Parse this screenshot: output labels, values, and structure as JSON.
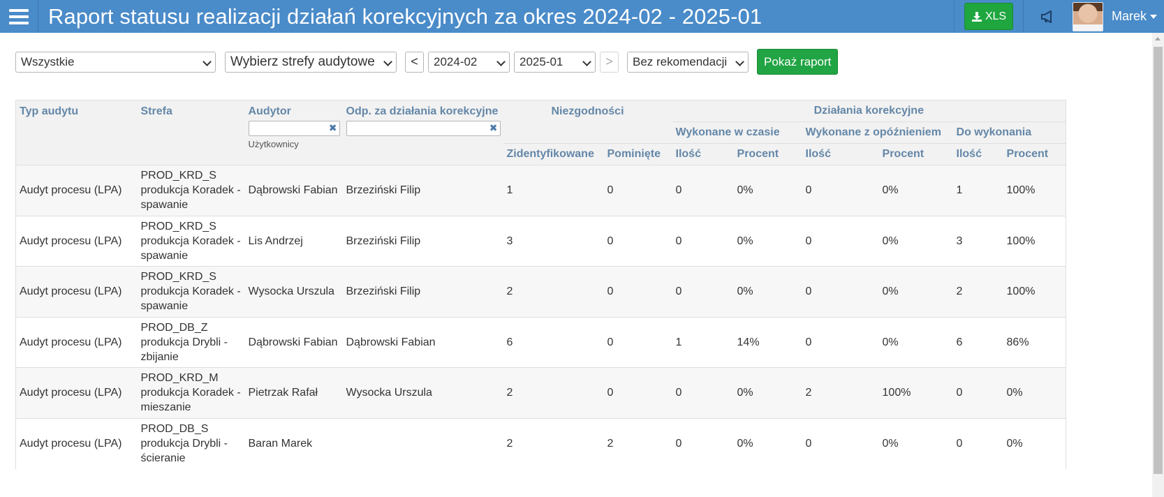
{
  "header": {
    "title": "Raport statusu realizacji działań korekcyjnych za okres 2024-02 - 2025-01",
    "xls_label": "XLS",
    "user_name": "Marek"
  },
  "filters": {
    "type_select": "Wszystkie",
    "zones_select": "Wybierz strefy audytowe",
    "prev_label": "<",
    "date_from": "2024-02",
    "date_to": "2025-01",
    "next_label": ">",
    "recommendation_select": "Bez rekomendacji",
    "show_report_label": "Pokaż raport"
  },
  "table": {
    "headers": {
      "typ_audytu": "Typ audytu",
      "strefa": "Strefa",
      "audytor": "Audytor",
      "audytor_sub": "Użytkownicy",
      "odp": "Odp. za działania korekcyjne",
      "niezgodnosci": "Niezgodności",
      "dzialania": "Działania korekcyjne",
      "wykonane_w_czasie": "Wykonane w czasie",
      "wykonane_z_opoznieniem": "Wykonane z opóźnieniem",
      "do_wykonania": "Do wykonania",
      "zidentyfikowane": "Zidentyfikowane",
      "pominiete": "Pominięte",
      "ilosc": "Ilość",
      "procent": "Procent"
    },
    "rows": [
      {
        "typ": "Audyt procesu (LPA)",
        "strefa_code": "PROD_KRD_S",
        "strefa_name": "produkcja Koradek -",
        "strefa_sub": "spawanie",
        "audytor": "Dąbrowski Fabian",
        "odp": "Brzeziński Filip",
        "zid": "1",
        "pom": "0",
        "wc_il": "0",
        "wc_pr": "0%",
        "wo_il": "0",
        "wo_pr": "0%",
        "dw_il": "1",
        "dw_pr": "100%"
      },
      {
        "typ": "Audyt procesu (LPA)",
        "strefa_code": "PROD_KRD_S",
        "strefa_name": "produkcja Koradek -",
        "strefa_sub": "spawanie",
        "audytor": "Lis Andrzej",
        "odp": "Brzeziński Filip",
        "zid": "3",
        "pom": "0",
        "wc_il": "0",
        "wc_pr": "0%",
        "wo_il": "0",
        "wo_pr": "0%",
        "dw_il": "3",
        "dw_pr": "100%"
      },
      {
        "typ": "Audyt procesu (LPA)",
        "strefa_code": "PROD_KRD_S",
        "strefa_name": "produkcja Koradek -",
        "strefa_sub": "spawanie",
        "audytor": "Wysocka Urszula",
        "odp": "Brzeziński Filip",
        "zid": "2",
        "pom": "0",
        "wc_il": "0",
        "wc_pr": "0%",
        "wo_il": "0",
        "wo_pr": "0%",
        "dw_il": "2",
        "dw_pr": "100%"
      },
      {
        "typ": "Audyt procesu (LPA)",
        "strefa_code": "PROD_DB_Z",
        "strefa_name": "produkcja Drybli -",
        "strefa_sub": "zbijanie",
        "audytor": "Dąbrowski Fabian",
        "odp": "Dąbrowski Fabian",
        "zid": "6",
        "pom": "0",
        "wc_il": "1",
        "wc_pr": "14%",
        "wo_il": "0",
        "wo_pr": "0%",
        "dw_il": "6",
        "dw_pr": "86%"
      },
      {
        "typ": "Audyt procesu (LPA)",
        "strefa_code": "PROD_KRD_M",
        "strefa_name": "produkcja Koradek -",
        "strefa_sub": "mieszanie",
        "audytor": "Pietrzak Rafał",
        "odp": "Wysocka Urszula",
        "zid": "2",
        "pom": "0",
        "wc_il": "0",
        "wc_pr": "0%",
        "wo_il": "2",
        "wo_pr": "100%",
        "dw_il": "0",
        "dw_pr": "0%"
      },
      {
        "typ": "Audyt procesu (LPA)",
        "strefa_code": "PROD_DB_S",
        "strefa_name": "produkcja Drybli -",
        "strefa_sub": "ścieranie",
        "audytor": "Baran Marek",
        "odp": "",
        "zid": "2",
        "pom": "2",
        "wc_il": "0",
        "wc_pr": "0%",
        "wo_il": "0",
        "wo_pr": "0%",
        "dw_il": "0",
        "dw_pr": "0%"
      }
    ]
  },
  "icons": {
    "menu": "hamburger-icon",
    "download": "download-icon",
    "announcements": "megaphone-icon",
    "clear": "clear-x-icon"
  }
}
